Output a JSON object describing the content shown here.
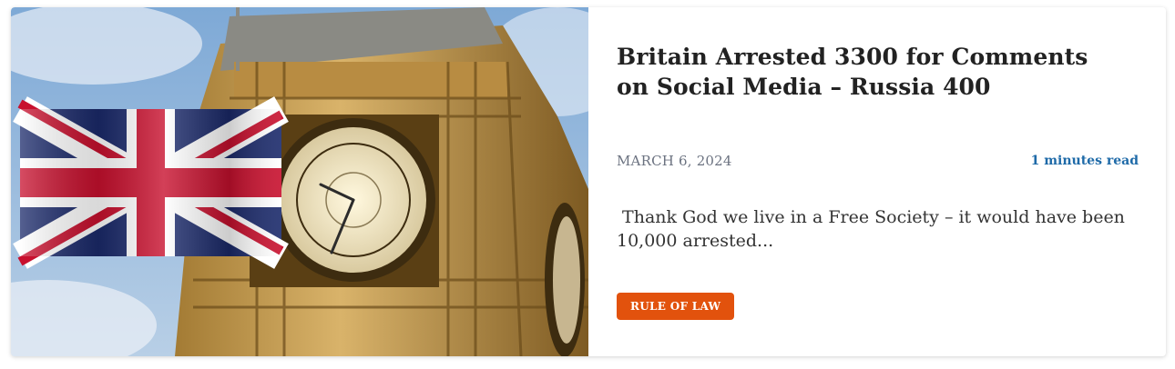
{
  "post": {
    "title": "Britain Arrested 3300 for Comments on Social Media – Russia 400",
    "date": "MARCH 6, 2024",
    "read_time": "1 minutes read",
    "excerpt": " Thank God we live in a Free Society – it would have been 10,000 arrested...",
    "category": "RULE OF LAW"
  },
  "thumbnail": {
    "icon": "big-ben-with-union-jack-image"
  },
  "colors": {
    "tag_background": "#e2520d",
    "read_time": "#1e6aa8",
    "title": "#222222"
  }
}
